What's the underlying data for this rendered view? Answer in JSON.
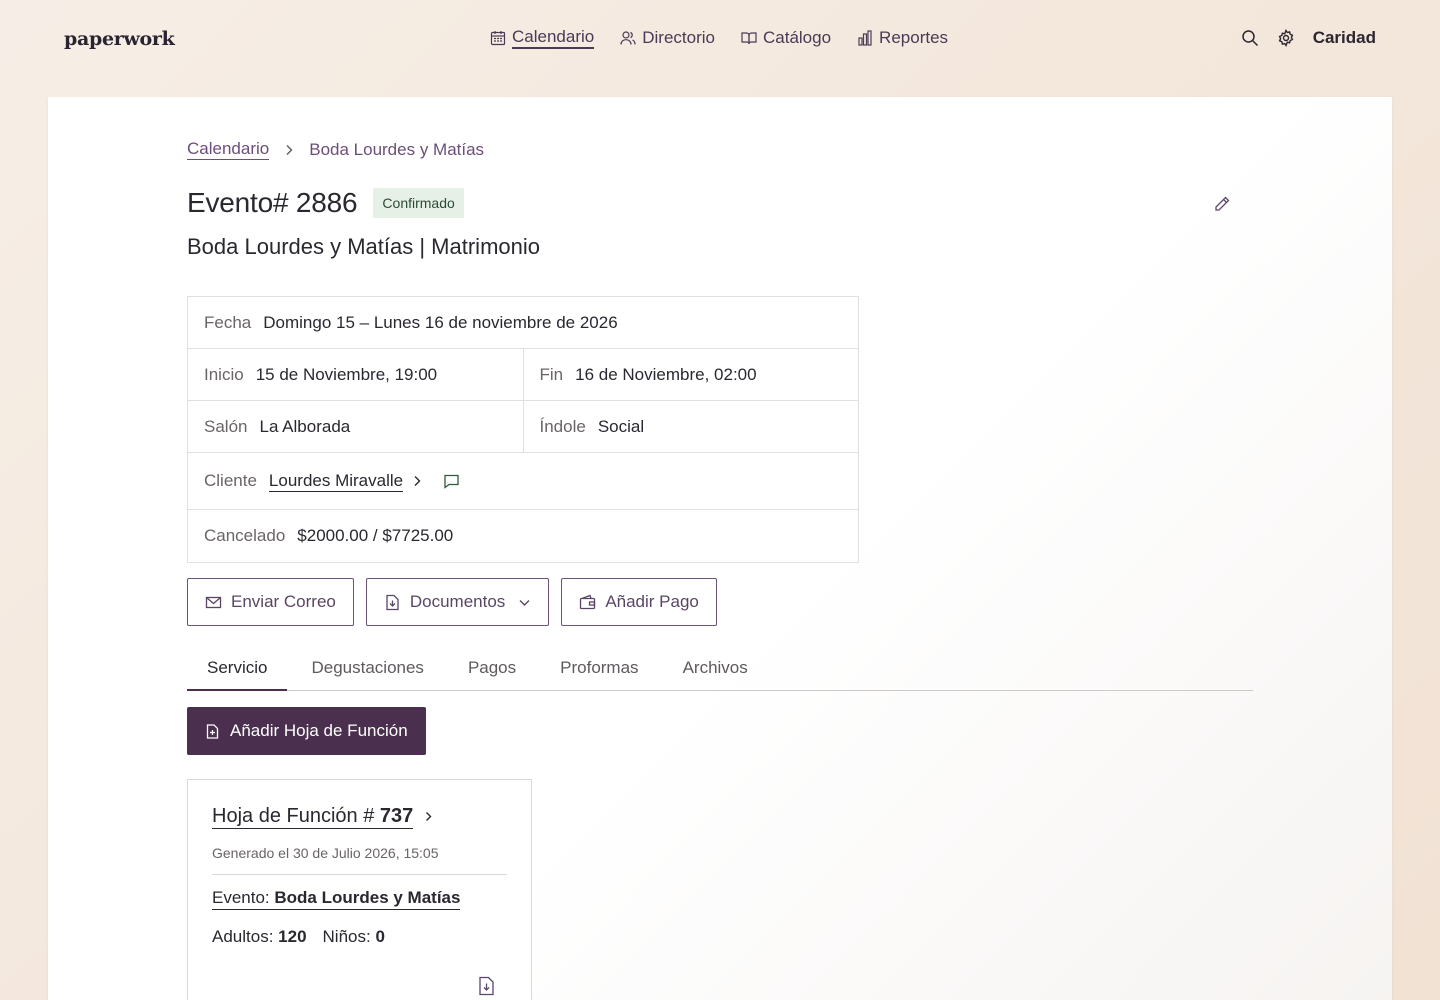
{
  "app": {
    "brand": "paperwork",
    "user": "Caridad"
  },
  "nav": [
    {
      "label": "Calendario",
      "icon": "calendar-icon",
      "active": true
    },
    {
      "label": "Directorio",
      "icon": "users-icon"
    },
    {
      "label": "Catálogo",
      "icon": "book-icon"
    },
    {
      "label": "Reportes",
      "icon": "bar-chart-icon"
    }
  ],
  "breadcrumb": {
    "parent": "Calendario",
    "current": "Boda Lourdes y Matías"
  },
  "event": {
    "title": "Evento# 2886",
    "status": "Confirmado",
    "subtitle": "Boda Lourdes y Matías | Matrimonio",
    "fecha_label": "Fecha",
    "fecha_value": "Domingo 15 – Lunes 16 de noviembre de 2026",
    "inicio_label": "Inicio",
    "inicio_value": "15 de Noviembre, 19:00",
    "fin_label": "Fin",
    "fin_value": "16 de Noviembre, 02:00",
    "salon_label": "Salón",
    "salon_value": "La Alborada",
    "indole_label": "Índole",
    "indole_value": "Social",
    "cliente_label": "Cliente",
    "cliente_value": "Lourdes Miravalle",
    "cancelado_label": "Cancelado",
    "cancelado_value": "$2000.00 / $7725.00"
  },
  "actions": {
    "email": "Enviar Correo",
    "documents": "Documentos",
    "payment": "Añadir Pago"
  },
  "tabs": [
    {
      "label": "Servicio",
      "active": true
    },
    {
      "label": "Degustaciones"
    },
    {
      "label": "Pagos"
    },
    {
      "label": "Proformas"
    },
    {
      "label": "Archivos"
    }
  ],
  "service": {
    "add_button": "Añadir Hoja de Función",
    "sheet": {
      "title_prefix": "Hoja de Función # ",
      "number": "737",
      "generated": "Generado el 30 de Julio 2026, 15:05",
      "event_label": "Evento: ",
      "event_value": "Boda Lourdes y Matías",
      "adults_label": "Adultos: ",
      "adults_value": "120",
      "children_label": "Niños: ",
      "children_value": "0"
    }
  }
}
